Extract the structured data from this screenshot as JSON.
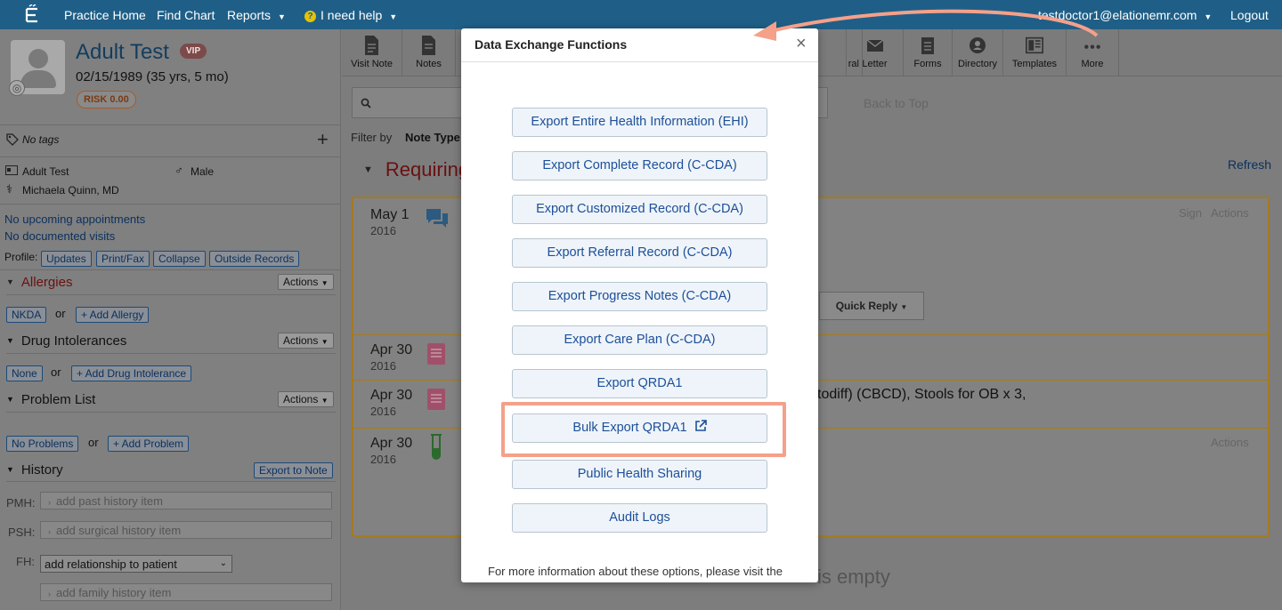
{
  "topnav": {
    "items": [
      "Practice Home",
      "Find Chart",
      "Reports",
      "I need help"
    ],
    "user": "testdoctor1@elationemr.com",
    "logout": "Logout"
  },
  "patient": {
    "name": "Adult Test",
    "vip": "VIP",
    "dob": "02/15/1989 (35 yrs, 5 mo)",
    "risk": "RISK 0.00",
    "tags": "No tags",
    "display_name": "Adult Test",
    "sex": "Male",
    "provider": "Michaela Quinn, MD",
    "appointments": "No upcoming appointments",
    "visits": "No documented visits"
  },
  "profile": {
    "label": "Profile:",
    "buttons": [
      "Updates",
      "Print/Fax",
      "Collapse",
      "Outside Records"
    ]
  },
  "sections": {
    "allergies": {
      "title": "Allergies",
      "actions": "Actions",
      "status": "NKDA",
      "or": "or",
      "add": "+ Add Allergy"
    },
    "drug": {
      "title": "Drug Intolerances",
      "actions": "Actions",
      "status": "None",
      "or": "or",
      "add": "+ Add Drug Intolerance"
    },
    "problems": {
      "title": "Problem List",
      "actions": "Actions",
      "status": "No Problems",
      "or": "or",
      "add": "+ Add Problem"
    },
    "history": {
      "title": "History",
      "export": "Export to Note",
      "pmh_label": "PMH:",
      "pmh_placeholder": "add past history item",
      "psh_label": "PSH:",
      "psh_placeholder": "add surgical history item",
      "fh_label": "FH:",
      "fh_select": "add relationship to patient",
      "fh_placeholder": "add family history item"
    }
  },
  "toolbar": {
    "visit_note": "Visit Note",
    "notes": "Notes",
    "referral": "Referral",
    "letter": "Letter",
    "forms": "Forms",
    "directory": "Directory",
    "templates": "Templates",
    "more": "More"
  },
  "main": {
    "back_to_top": "Back to Top",
    "filter_by": "Filter by",
    "note_type": "Note Type",
    "requiring": "Requiring",
    "refresh": "Refresh",
    "notes": [
      {
        "date": "May 1",
        "year": "2016",
        "sign": "Sign",
        "actions": "Actions"
      },
      {
        "date": "Apr 30",
        "year": "2016"
      },
      {
        "date": "Apr 30",
        "year": "2016"
      },
      {
        "date": "Apr 30",
        "year": "2016",
        "actions": "Actions"
      }
    ],
    "quick_reply": "Quick Reply",
    "note_fragment": "todiff) (CBCD), Stools for OB x 3,",
    "empty_fragment": "is empty"
  },
  "modal": {
    "title": "Data Exchange Functions",
    "buttons": [
      "Export Entire Health Information (EHI)",
      "Export Complete Record (C-CDA)",
      "Export Customized Record (C-CDA)",
      "Export Referral Record (C-CDA)",
      "Export Progress Notes (C-CDA)",
      "Export Care Plan (C-CDA)",
      "Export QRDA1",
      "Bulk Export QRDA1",
      "Public Health Sharing",
      "Audit Logs"
    ],
    "footer": "For more information about these options, please visit the"
  },
  "colors": {
    "nav_bg": "#1f5f87",
    "modal_link": "#1d4f9a",
    "highlight": "#f5a08a"
  }
}
